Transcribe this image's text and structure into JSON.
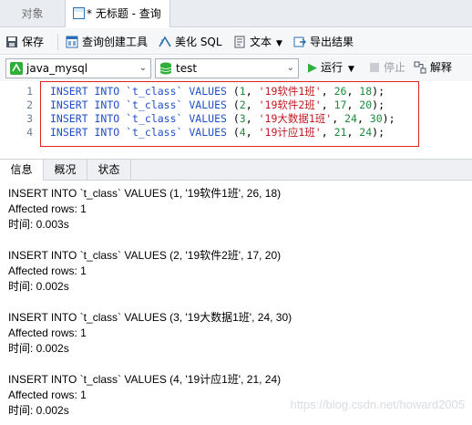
{
  "tabs": {
    "objects": "对象",
    "query": "* 无标题 - 查询"
  },
  "toolbar": {
    "save": "保存",
    "query_builder": "查询创建工具",
    "beautify": "美化 SQL",
    "text": "文本",
    "export": "导出结果"
  },
  "selectors": {
    "connection": "java_mysql",
    "database": "test",
    "run": "运行",
    "stop": "停止",
    "explain": "解释"
  },
  "editor": {
    "lines": [
      {
        "n": "1",
        "kw1": "INSERT",
        "kw2": "INTO",
        "table": "`t_class`",
        "kw3": "VALUES",
        "open": "(",
        "id": "1",
        "name": "'19软件1班'",
        "a": "26",
        "b": "18",
        "close": ");"
      },
      {
        "n": "2",
        "kw1": "INSERT",
        "kw2": "INTO",
        "table": "`t_class`",
        "kw3": "VALUES",
        "open": "(",
        "id": "2",
        "name": "'19软件2班'",
        "a": "17",
        "b": "20",
        "close": ");"
      },
      {
        "n": "3",
        "kw1": "INSERT",
        "kw2": "INTO",
        "table": "`t_class`",
        "kw3": "VALUES",
        "open": "(",
        "id": "3",
        "name": "'19大数据1班'",
        "a": "24",
        "b": "30",
        "close": ");"
      },
      {
        "n": "4",
        "kw1": "INSERT",
        "kw2": "INTO",
        "table": "`t_class`",
        "kw3": "VALUES",
        "open": "(",
        "id": "4",
        "name": "'19计应1班'",
        "a": "21",
        "b": "24",
        "close": ");"
      }
    ]
  },
  "result_tabs": [
    "信息",
    "概况",
    "状态"
  ],
  "output": [
    {
      "sql": "INSERT INTO `t_class` VALUES (1, '19软件1班', 26, 18)",
      "rows": "Affected rows: 1",
      "time": "时间: 0.003s"
    },
    {
      "sql": "INSERT INTO `t_class` VALUES (2, '19软件2班', 17, 20)",
      "rows": "Affected rows: 1",
      "time": "时间: 0.002s"
    },
    {
      "sql": "INSERT INTO `t_class` VALUES (3, '19大数据1班', 24, 30)",
      "rows": "Affected rows: 1",
      "time": "时间: 0.002s"
    },
    {
      "sql": "INSERT INTO `t_class` VALUES (4, '19计应1班', 21, 24)",
      "rows": "Affected rows: 1",
      "time": "时间: 0.002s"
    }
  ],
  "watermark": "https://blog.csdn.net/howard2005",
  "colors": {
    "keyword": "#1f4fc8",
    "string": "#c0181f",
    "number": "#1d8b3a",
    "highlight_box": "#e02424",
    "run_icon": "#2fae3a"
  },
  "icons": {
    "save": "save-icon",
    "query_builder": "query-builder-icon",
    "beautify": "beautify-icon",
    "text": "text-icon",
    "export": "export-icon",
    "connection": "connection-icon",
    "database": "database-icon",
    "run": "run-icon",
    "stop": "stop-icon",
    "explain": "explain-icon"
  }
}
